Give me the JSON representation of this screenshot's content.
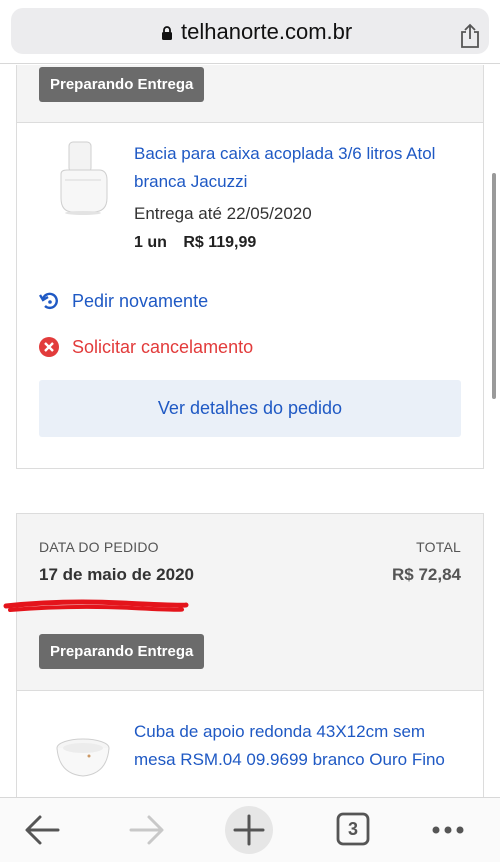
{
  "browser": {
    "url": "telhanorte.com.br",
    "tab_count": "3",
    "icons": [
      "lock-icon",
      "share-icon",
      "back-arrow-icon",
      "forward-arrow-icon",
      "new-tab-plus-icon",
      "tabs-icon",
      "more-icon"
    ]
  },
  "order1": {
    "status": "Preparando Entrega",
    "product_name": "Bacia para caixa acoplada 3/6 litros Atol branca Jacuzzi",
    "delivery": "Entrega até 22/05/2020",
    "quantity": "1 un",
    "price": "R$ 119,99",
    "reorder_label": "Pedir novamente",
    "cancel_label": "Solicitar cancelamento",
    "details_label": "Ver detalhes do pedido"
  },
  "order2": {
    "date_label": "DATA DO PEDIDO",
    "date_value": "17 de maio de 2020",
    "total_label": "TOTAL",
    "total_value": "R$ 72,84",
    "status": "Preparando Entrega",
    "product_name": "Cuba de apoio redonda 43X12cm sem mesa RSM.04 09.9699 branco Ouro Fino"
  },
  "colors": {
    "link_blue": "#1f59c4",
    "cancel_red": "#e23b3b",
    "badge_gray": "#6b6b6b",
    "details_bg": "#eaf0f8"
  }
}
